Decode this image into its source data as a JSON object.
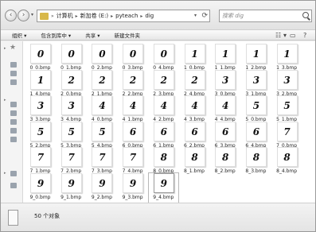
{
  "address": {
    "path": [
      "计算机",
      "新加卷 (E:)",
      "pyteach",
      "dig"
    ],
    "search_placeholder": "搜索 dig"
  },
  "toolbar": {
    "organize": "组织 ▾",
    "include": "包含到库中 ▾",
    "share": "共享 ▾",
    "new_folder": "新建文件夹"
  },
  "files": [
    {
      "name": "0_0.bmp",
      "digit": "0"
    },
    {
      "name": "0_1.bmp",
      "digit": "0"
    },
    {
      "name": "0_2.bmp",
      "digit": "0"
    },
    {
      "name": "0_3.bmp",
      "digit": "0"
    },
    {
      "name": "0_4.bmp",
      "digit": "0"
    },
    {
      "name": "1_0.bmp",
      "digit": "1"
    },
    {
      "name": "1_1.bmp",
      "digit": "1"
    },
    {
      "name": "1_2.bmp",
      "digit": "1"
    },
    {
      "name": "1_3.bmp",
      "digit": "1"
    },
    {
      "name": "1_4.bmp",
      "digit": "1"
    },
    {
      "name": "2_0.bmp",
      "digit": "2"
    },
    {
      "name": "2_1.bmp",
      "digit": "2"
    },
    {
      "name": "2_2.bmp",
      "digit": "2"
    },
    {
      "name": "2_3.bmp",
      "digit": "2"
    },
    {
      "name": "2_4.bmp",
      "digit": "2"
    },
    {
      "name": "3_0.bmp",
      "digit": "3"
    },
    {
      "name": "3_1.bmp",
      "digit": "3"
    },
    {
      "name": "3_2.bmp",
      "digit": "3"
    },
    {
      "name": "3_3.bmp",
      "digit": "3"
    },
    {
      "name": "3_4.bmp",
      "digit": "3"
    },
    {
      "name": "4_0.bmp",
      "digit": "4"
    },
    {
      "name": "4_1.bmp",
      "digit": "4"
    },
    {
      "name": "4_2.bmp",
      "digit": "4"
    },
    {
      "name": "4_3.bmp",
      "digit": "4"
    },
    {
      "name": "4_4.bmp",
      "digit": "4"
    },
    {
      "name": "5_0.bmp",
      "digit": "5"
    },
    {
      "name": "5_1.bmp",
      "digit": "5"
    },
    {
      "name": "5_2.bmp",
      "digit": "5"
    },
    {
      "name": "5_3.bmp",
      "digit": "5"
    },
    {
      "name": "5_4.bmp",
      "digit": "5"
    },
    {
      "name": "6_0.bmp",
      "digit": "6"
    },
    {
      "name": "6_1.bmp",
      "digit": "6"
    },
    {
      "name": "6_2.bmp",
      "digit": "6"
    },
    {
      "name": "6_3.bmp",
      "digit": "6"
    },
    {
      "name": "6_4.bmp",
      "digit": "6"
    },
    {
      "name": "7_0.bmp",
      "digit": "7"
    },
    {
      "name": "7_1.bmp",
      "digit": "7"
    },
    {
      "name": "7_2.bmp",
      "digit": "7"
    },
    {
      "name": "7_3.bmp",
      "digit": "7"
    },
    {
      "name": "7_4.bmp",
      "digit": "7"
    },
    {
      "name": "8_0.bmp",
      "digit": "8"
    },
    {
      "name": "8_1.bmp",
      "digit": "8"
    },
    {
      "name": "8_2.bmp",
      "digit": "8"
    },
    {
      "name": "8_3.bmp",
      "digit": "8"
    },
    {
      "name": "8_4.bmp",
      "digit": "8"
    },
    {
      "name": "9_0.bmp",
      "digit": "9"
    },
    {
      "name": "9_1.bmp",
      "digit": "9"
    },
    {
      "name": "9_2.bmp",
      "digit": "9"
    },
    {
      "name": "9_3.bmp",
      "digit": "9"
    },
    {
      "name": "9_4.bmp",
      "digit": "9"
    }
  ],
  "status": {
    "count_text": "50 个对象"
  }
}
